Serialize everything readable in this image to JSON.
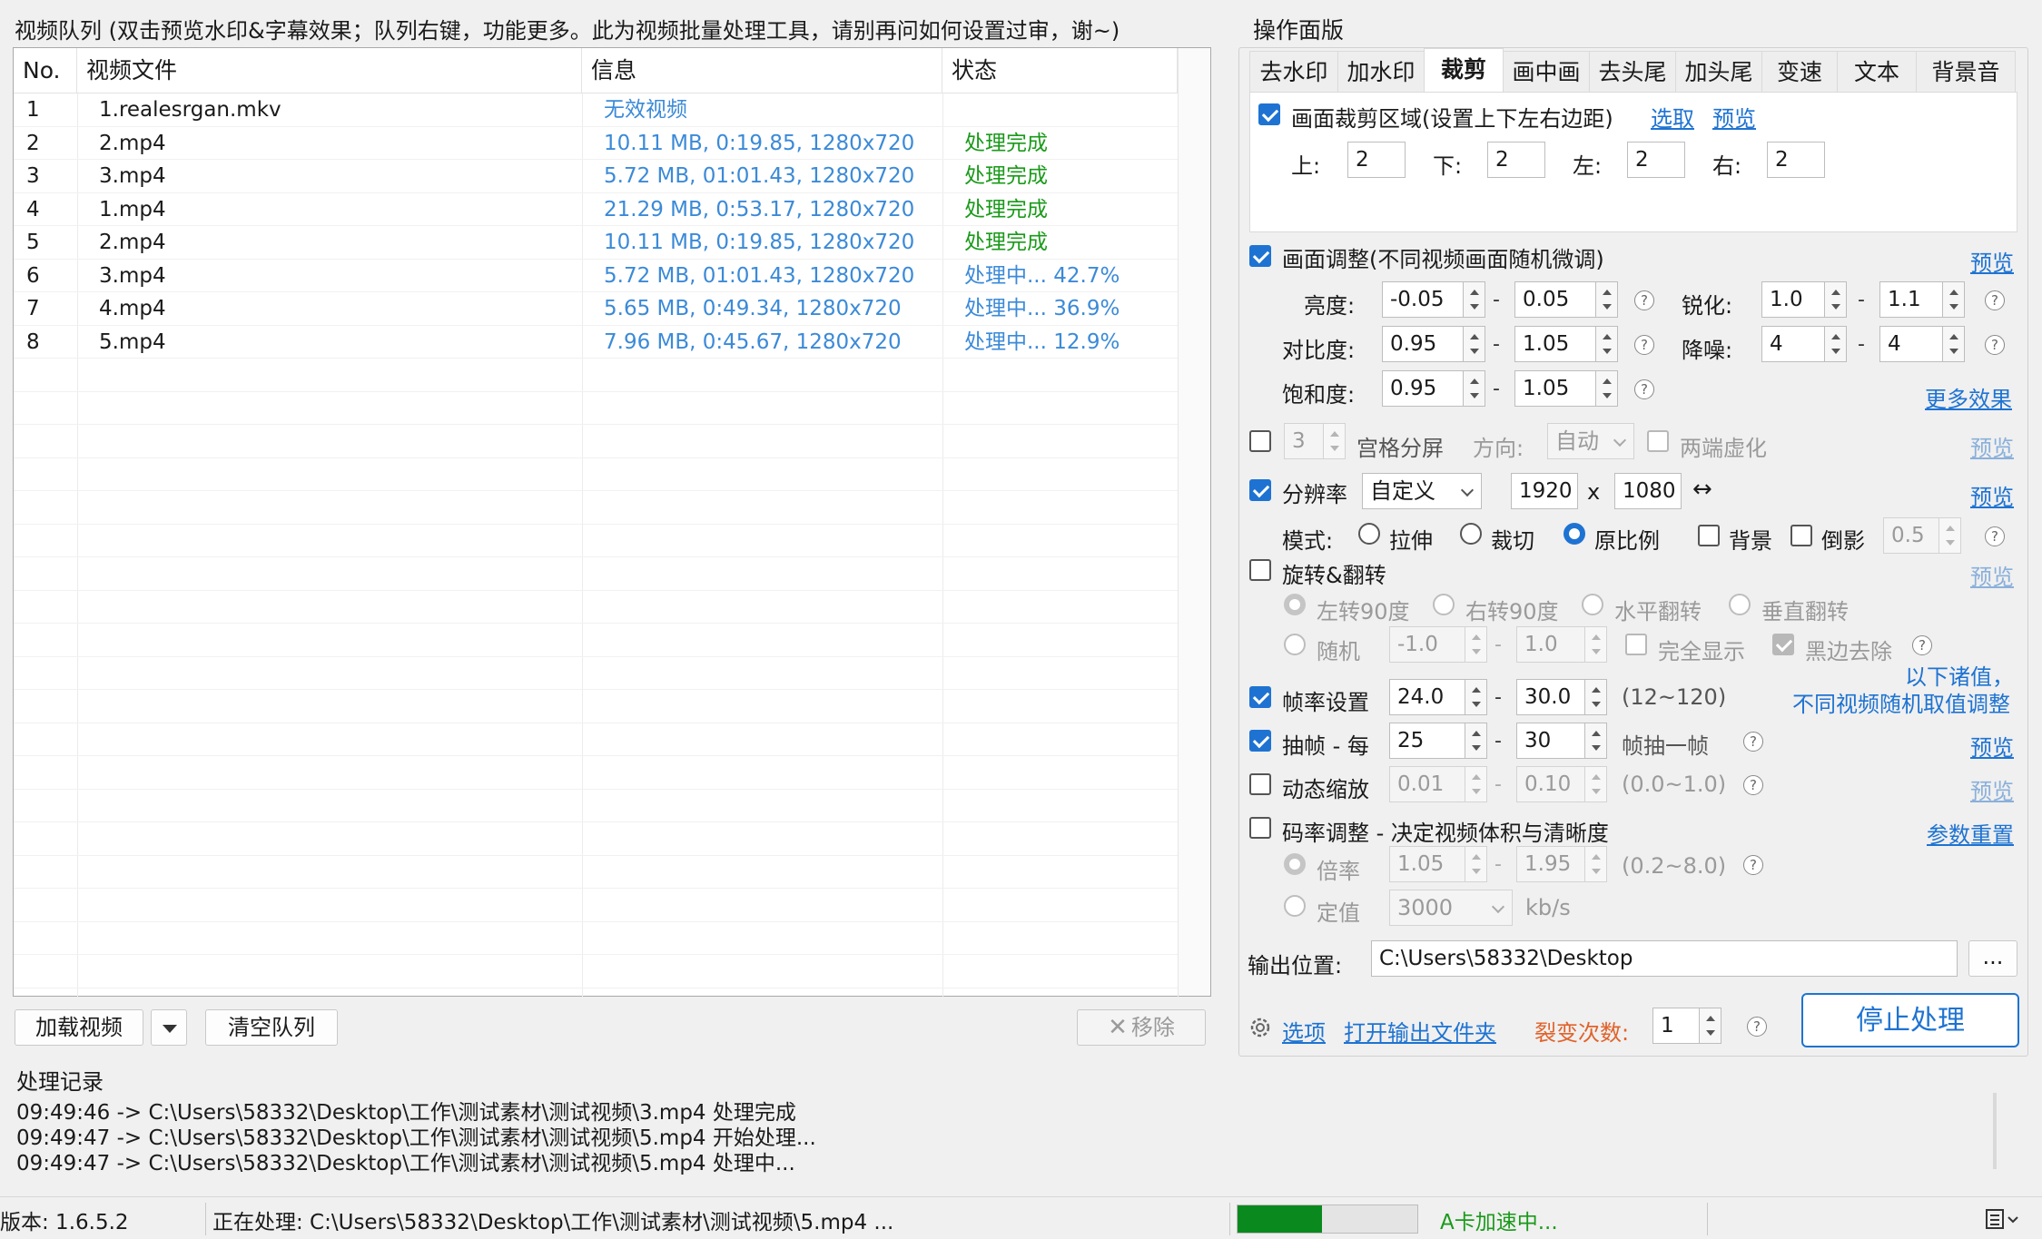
{
  "queue": {
    "title": "视频队列 (双击预览水印&字幕效果；队列右键，功能更多。此为视频批量处理工具，请别再问如何设置过审，谢~)",
    "columns": {
      "no": "No.",
      "file": "视频文件",
      "info": "信息",
      "status": "状态"
    },
    "rows": [
      {
        "no": "1",
        "file": "1.realesrgan.mkv",
        "info": "无效视频",
        "status": "",
        "state": "invalid"
      },
      {
        "no": "2",
        "file": "2.mp4",
        "info": "10.11 MB, 0:19.85, 1280x720",
        "status": "处理完成",
        "state": "done"
      },
      {
        "no": "3",
        "file": "3.mp4",
        "info": "5.72 MB, 01:01.43, 1280x720",
        "status": "处理完成",
        "state": "done"
      },
      {
        "no": "4",
        "file": "1.mp4",
        "info": "21.29 MB, 0:53.17, 1280x720",
        "status": "处理完成",
        "state": "done"
      },
      {
        "no": "5",
        "file": "2.mp4",
        "info": "10.11 MB, 0:19.85, 1280x720",
        "status": "处理完成",
        "state": "done"
      },
      {
        "no": "6",
        "file": "3.mp4",
        "info": "5.72 MB, 01:01.43, 1280x720",
        "status": "处理中... 42.7%",
        "state": "processing"
      },
      {
        "no": "7",
        "file": "4.mp4",
        "info": "5.65 MB, 0:49.34, 1280x720",
        "status": "处理中... 36.9%",
        "state": "processing"
      },
      {
        "no": "8",
        "file": "5.mp4",
        "info": "7.96 MB, 0:45.67, 1280x720",
        "status": "处理中... 12.9%",
        "state": "processing"
      }
    ],
    "buttons": {
      "load": "加载视频",
      "clear": "清空队列",
      "remove": "移除"
    }
  },
  "panel": {
    "title": "操作面版",
    "tabs": [
      "去水印",
      "加水印",
      "裁剪",
      "画中画",
      "去头尾",
      "加头尾",
      "变速",
      "文本",
      "背景音"
    ],
    "active_tab": 2,
    "crop": {
      "label": "画面裁剪区域(设置上下左右边距)",
      "checked": true,
      "pick": "选取",
      "preview": "预览",
      "top_label": "上:",
      "top": "2",
      "bottom_label": "下:",
      "bottom": "2",
      "left_label": "左:",
      "left": "2",
      "right_label": "右:",
      "right": "2"
    },
    "adjust": {
      "label": "画面调整(不同视频画面随机微调)",
      "checked": true,
      "preview": "预览",
      "brightness_label": "亮度:",
      "brightness_min": "-0.05",
      "brightness_max": "0.05",
      "sharpen_label": "锐化:",
      "sharpen_min": "1.0",
      "sharpen_max": "1.1",
      "contrast_label": "对比度:",
      "contrast_min": "0.95",
      "contrast_max": "1.05",
      "denoise_label": "降噪:",
      "denoise_min": "4",
      "denoise_max": "4",
      "saturation_label": "饱和度:",
      "saturation_min": "0.95",
      "saturation_max": "1.05",
      "more": "更多效果"
    },
    "grid": {
      "count": "3",
      "label": "宫格分屏",
      "direction_label": "方向:",
      "direction": "自动",
      "blur_label": "两端虚化",
      "preview": "预览"
    },
    "resolution": {
      "label": "分辨率",
      "checked": true,
      "mode": "自定义",
      "width": "1920",
      "x": "x",
      "height": "1080",
      "swap": "↔",
      "preview": "预览",
      "mode_label": "模式:",
      "stretch": "拉伸",
      "crop": "裁切",
      "keep": "原比例",
      "bg_label": "背景",
      "reflect_label": "倒影",
      "reflect_val": "0.5"
    },
    "rotate": {
      "label": "旋转&翻转",
      "preview": "预览",
      "left90": "左转90度",
      "right90": "右转90度",
      "hflip": "水平翻转",
      "vflip": "垂直翻转",
      "random": "随机",
      "rand_min": "-1.0",
      "rand_max": "1.0",
      "full": "完全显示",
      "black": "黑边去除"
    },
    "note_line1": "以下诸值，",
    "note_line2": "不同视频随机取值调整",
    "fps": {
      "label": "帧率设置",
      "checked": true,
      "min": "24.0",
      "max": "30.0",
      "range": "(12~120)"
    },
    "drop": {
      "label": "抽帧 - 每",
      "checked": true,
      "min": "25",
      "max": "30",
      "suffix": "帧抽一帧",
      "preview": "预览"
    },
    "zoom": {
      "label": "动态缩放",
      "checked": false,
      "min": "0.01",
      "max": "0.10",
      "range": "(0.0~1.0)",
      "preview": "预览"
    },
    "bitrate": {
      "label": "码率调整 - 决定视频体积与清晰度",
      "checked": false,
      "reset": "参数重置",
      "ratio_label": "倍率",
      "ratio_min": "1.05",
      "ratio_max": "1.95",
      "ratio_range": "(0.2~8.0)",
      "fixed_label": "定值",
      "fixed_val": "3000",
      "unit": "kb/s"
    },
    "output": {
      "label": "输出位置:",
      "path": "C:\\Users\\58332\\Desktop",
      "browse": "..."
    },
    "options": "选项",
    "open_folder": "打开输出文件夹",
    "fission_label": "裂变次数:",
    "fission_val": "1",
    "stop": "停止处理"
  },
  "log": {
    "title": "处理记录",
    "lines": [
      "09:49:46 -> C:\\Users\\58332\\Desktop\\工作\\测试素材\\测试视频\\3.mp4 处理完成",
      "09:49:47 -> C:\\Users\\58332\\Desktop\\工作\\测试素材\\测试视频\\5.mp4 开始处理...",
      "09:49:47 -> C:\\Users\\58332\\Desktop\\工作\\测试素材\\测试视频\\5.mp4 处理中..."
    ]
  },
  "statusbar": {
    "version": "版本: 1.6.5.2",
    "processing": "正在处理: C:\\Users\\58332\\Desktop\\工作\\测试素材\\测试视频\\5.mp4 ...",
    "progress": 0.47,
    "gpu": "A卡加速中..."
  },
  "colors": {
    "accent": "#1e73d2",
    "done": "#1a9a1a",
    "info": "#3b8ad8",
    "warn": "#e0622a",
    "progress": "#0a8a1e"
  }
}
